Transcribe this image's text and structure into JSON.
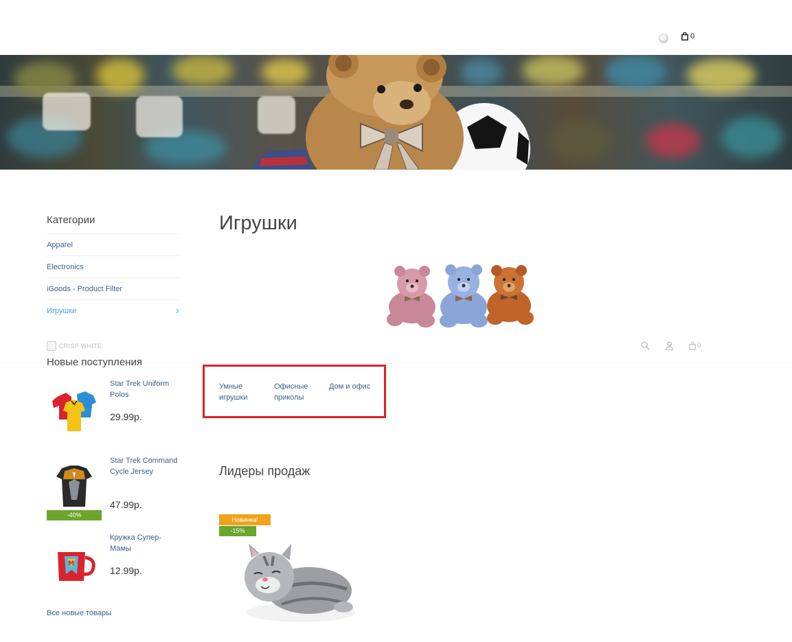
{
  "header": {
    "cart_count": "0"
  },
  "sidebar": {
    "categories_title": "Категории",
    "categories": [
      {
        "label": "Apparel"
      },
      {
        "label": "Electronics"
      },
      {
        "label": "iGoods - Product Filter"
      },
      {
        "label": "Игрушки",
        "active": true
      }
    ]
  },
  "sticky": {
    "logo_text": "CRISP WHITE",
    "cart_count": "0"
  },
  "new_arrivals": {
    "title": "Новые поступления",
    "items": [
      {
        "name": "Star Trek Uniform Polos",
        "price": "29.99р."
      },
      {
        "name": "Star Trek Command Cycle Jersey",
        "price": "47.99р.",
        "badge": "-40%"
      },
      {
        "name": "Кружка Супер-Мамы",
        "price": "12.99р."
      }
    ],
    "all_link": "Все новые товары"
  },
  "main": {
    "title": "Игрушки",
    "subcategories": [
      {
        "label": "Умные игрушки"
      },
      {
        "label": "Офисные приколы"
      },
      {
        "label": "Дом и офис"
      }
    ],
    "bestsellers_title": "Лидеры продаж",
    "bestseller_badges": {
      "new": "Новинка!",
      "sale": "-15%"
    }
  },
  "colors": {
    "link": "#3b5f8c",
    "active": "#4aa3d8",
    "highlight_border": "#dd1f2a",
    "badge_new": "#f0a21c",
    "badge_sale": "#6aa62b"
  }
}
